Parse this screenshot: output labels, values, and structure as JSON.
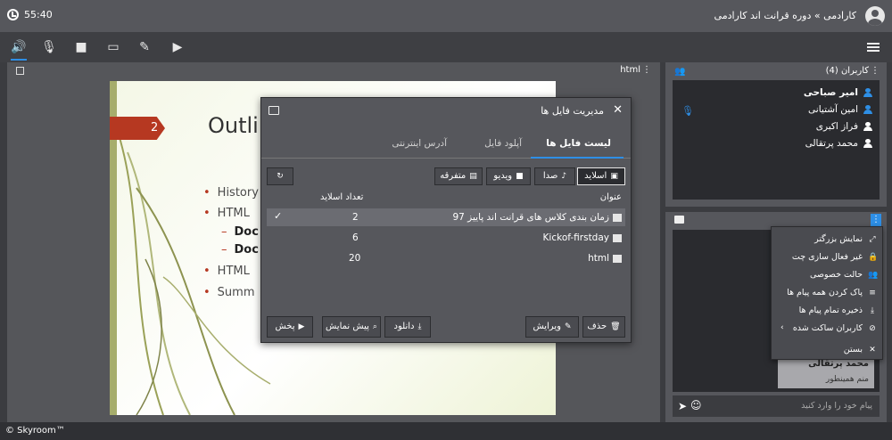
{
  "topbar": {
    "time": "55:40",
    "room_title": "کارادمی » دوره قرانت اند کارادمی"
  },
  "toolbar": {
    "icons": [
      "speaker-icon",
      "mic-muted-icon",
      "camera-icon",
      "laptop-icon",
      "brush-icon",
      "play-box-icon"
    ]
  },
  "stage": {
    "label": "html",
    "slide": {
      "number": "2",
      "title": "Outli",
      "bullets": [
        "History",
        "HTML",
        "Doc",
        "Doc",
        "HTML",
        "Summ"
      ]
    }
  },
  "dialog": {
    "title": "مدیریت فایل ها",
    "tabs": [
      "لیست فایل ها",
      "آپلود فایل",
      "آدرس اینترنتی"
    ],
    "filters": [
      "اسلاید",
      "صدا",
      "ویدیو",
      "متفرقه"
    ],
    "columns": {
      "name": "عنوان",
      "count": "تعداد اسلاید"
    },
    "rows": [
      {
        "name": "زمان بندی کلاس های قرانت اند پاییز 97",
        "count": "2",
        "selected": true
      },
      {
        "name": "Kickof-firstday",
        "count": "6",
        "selected": false
      },
      {
        "name": "html",
        "count": "20",
        "selected": false
      }
    ],
    "actions": {
      "delete": "حذف",
      "edit": "ویرایش",
      "download": "دانلود",
      "preview": "پیش نمایش",
      "play": "پخش"
    }
  },
  "users_panel": {
    "title": "کاربران (4)",
    "users": [
      {
        "name": "امیر صباحی",
        "bold": true,
        "mic": false,
        "color": "#2e8fe6"
      },
      {
        "name": "امین آشتیانی",
        "bold": false,
        "mic": true,
        "color": "#2e8fe6"
      },
      {
        "name": "فراز اکبری",
        "bold": false,
        "mic": false,
        "color": "#ffffff"
      },
      {
        "name": "محمد پرتقالی",
        "bold": false,
        "mic": false,
        "color": "#ffffff"
      }
    ]
  },
  "chat": {
    "message": {
      "sender": "محمد پرتقالی",
      "text": "منم همینطور"
    },
    "placeholder": "پیام خود را وارد کنید"
  },
  "context_menu": {
    "items": [
      {
        "label": "نمایش بزرگتر",
        "icon": "expand-icon"
      },
      {
        "label": "غیر فعال سازی چت",
        "icon": "lock-icon"
      },
      {
        "label": "حالت خصوصی",
        "icon": "group-icon"
      },
      {
        "label": "پاک کردن همه پیام ها",
        "icon": "clear-icon"
      },
      {
        "label": "ذخیره تمام پیام ها",
        "icon": "download-icon"
      },
      {
        "label": "کاربران ساکت شده",
        "icon": "block-icon"
      },
      {
        "label": "بستن",
        "icon": "close-icon"
      }
    ]
  },
  "footer": {
    "brand": "© Skyroom™"
  },
  "colors": {
    "accent": "#2e8fe6",
    "slide_accent": "#b63821"
  }
}
